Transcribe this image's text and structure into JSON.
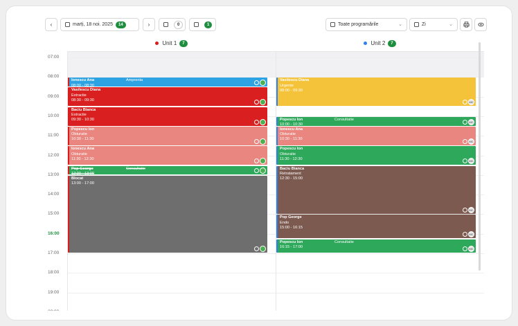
{
  "toolbar": {
    "prev_icon": "chevron-left-icon",
    "date_label": "marți, 18 noi. 2025",
    "date_badge": "14",
    "next_icon": "chevron-right-icon",
    "waiting_badge": "0",
    "pending_badge": "1",
    "filter_value": "Toate programările",
    "view_value": "Zi",
    "print_icon": "printer-icon",
    "visibility_icon": "eye-icon"
  },
  "units": [
    {
      "name": "Unit 1",
      "count": "7",
      "dot_color": "#d81b1b"
    },
    {
      "name": "Unit 2",
      "count": "7",
      "dot_color": "#2f80ed"
    }
  ],
  "times": [
    "07:00",
    "08:00",
    "09:00",
    "10:00",
    "11:00",
    "12:00",
    "13:00",
    "14:00",
    "15:00",
    "16:00",
    "17:00",
    "18:00",
    "19:00",
    "20:00"
  ],
  "current_hour": "16:00",
  "unit1_events": [
    {
      "name": "Ionescu Ana",
      "service": "",
      "time": "08:00 - 08:30",
      "side": "Amprenta",
      "color": "#2ea3e3",
      "start": 8.0,
      "end": 8.5,
      "avatar": "img"
    },
    {
      "name": "Vasilescu Diana",
      "service": "Extractie",
      "time": "08:30 - 09:30",
      "side": "",
      "color": "#d91f1f",
      "start": 8.5,
      "end": 9.5,
      "avatar": "img"
    },
    {
      "name": "Baciu Bianca",
      "service": "Extractie",
      "time": "09:30 - 10:30",
      "side": "",
      "color": "#d91f1f",
      "start": 9.5,
      "end": 10.5,
      "avatar": "img"
    },
    {
      "name": "Popescu Ion",
      "service": "Obturatie",
      "time": "10:30 - 11:30",
      "side": "",
      "color": "#e8867f",
      "start": 10.5,
      "end": 11.5,
      "avatar": "img"
    },
    {
      "name": "Ionescu Ana",
      "service": "Obturatie",
      "time": "11:30 - 12:30",
      "side": "",
      "color": "#e8867f",
      "start": 11.5,
      "end": 12.5,
      "avatar": "img"
    },
    {
      "name": "Pop George",
      "service": "",
      "time": "12:30 - 13:00",
      "side": "Consultatie",
      "color": "#2ea85a",
      "start": 12.5,
      "end": 13.0,
      "avatar": "img",
      "strike": true
    },
    {
      "name": "Blocat",
      "service": "",
      "time": "13:00 - 17:00",
      "side": "",
      "color": "#6e6e6e",
      "start": 13.0,
      "end": 17.0,
      "avatar": "img",
      "light": true
    }
  ],
  "unit2_events": [
    {
      "name": "Vasilescu Diana",
      "service": "Urgente",
      "time": "08:00 - 09:30",
      "side": "",
      "color": "#f4c33a",
      "start": 8.0,
      "end": 9.5,
      "avatar": "MC"
    },
    {
      "name": "Popescu Ion",
      "service": "",
      "time": "10:00 - 10:30",
      "side": "Consultatie",
      "color": "#2ea85a",
      "start": 10.0,
      "end": 10.5,
      "avatar": "MC"
    },
    {
      "name": "Ionescu Ana",
      "service": "Obturatie",
      "time": "10:30 - 11:30",
      "side": "",
      "color": "#e8867f",
      "start": 10.5,
      "end": 11.5,
      "avatar": "MC"
    },
    {
      "name": "Popescu Ion",
      "service": "Obturatie",
      "time": "11:30 - 12:30",
      "side": "",
      "color": "#2ea85a",
      "start": 11.5,
      "end": 12.5,
      "avatar": "MC"
    },
    {
      "name": "Baciu Bianca",
      "service": "Retratament",
      "time": "12:30 - 15:00",
      "side": "",
      "color": "#7c5a4f",
      "start": 12.5,
      "end": 15.0,
      "avatar": "MC"
    },
    {
      "name": "Pop George",
      "service": "Endo",
      "time": "15:00 - 16:15",
      "side": "",
      "color": "#7c5a4f",
      "start": 15.0,
      "end": 16.25,
      "avatar": "MC"
    },
    {
      "name": "Popescu Ion",
      "service": "",
      "time": "16:15 - 17:00",
      "side": "Consultatie",
      "color": "#2ea85a",
      "start": 16.25,
      "end": 17.0,
      "avatar": "MC"
    }
  ]
}
